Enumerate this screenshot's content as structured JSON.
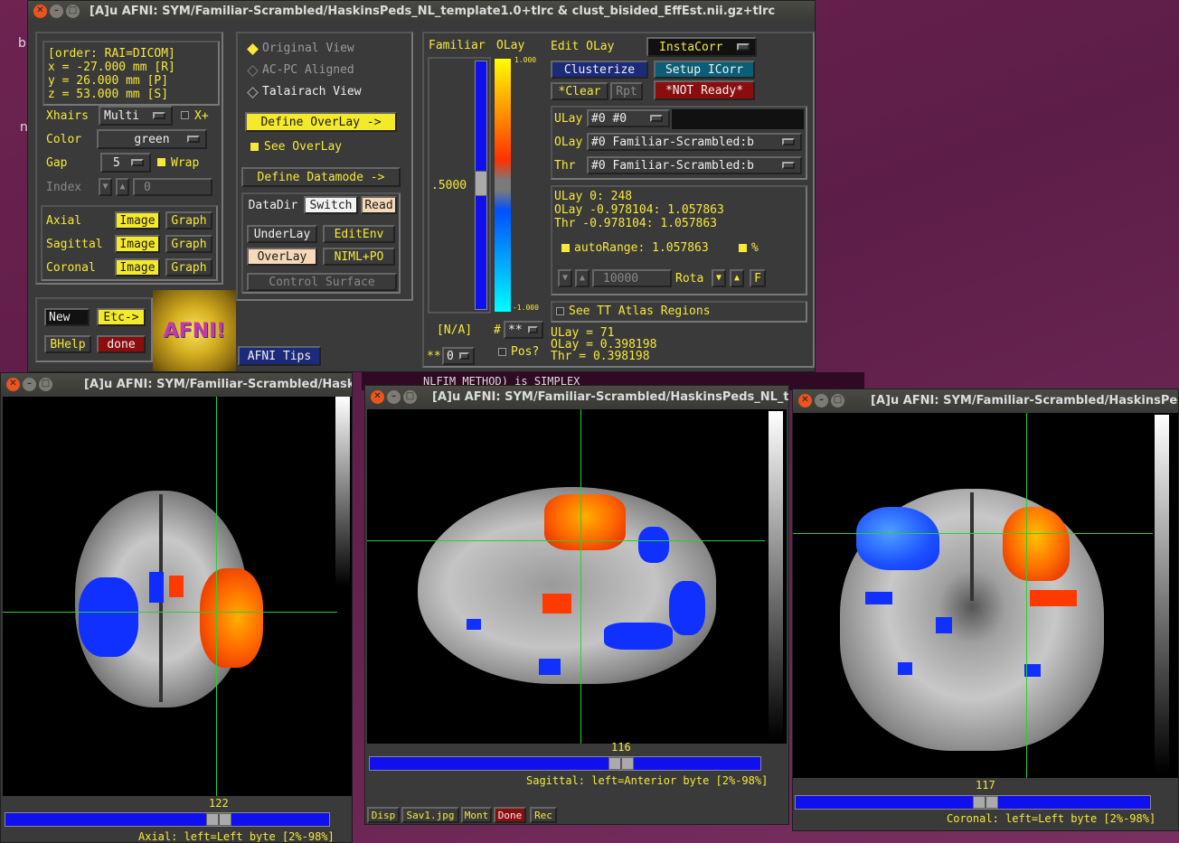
{
  "desktop": {
    "left_text_1": "b",
    "left_text_2": "n"
  },
  "control": {
    "title": "[A]u AFNI: SYM/Familiar-Scrambled/HaskinsPeds_NL_template1.0+tlrc & clust_bisided_EffEst.nii.gz+tlrc",
    "coords": {
      "order": "[order: RAI=DICOM]",
      "x": "x =   -27.000 mm [R]",
      "y": "y =    26.000 mm [P]",
      "z": "z =    53.000 mm [S]"
    },
    "xhairs_label": "Xhairs",
    "xhairs_value": "Multi",
    "xplus": "X+",
    "color_label": "Color",
    "color_value": "green",
    "gap_label": "Gap",
    "gap_value": "5",
    "wrap": "Wrap",
    "index_label": "Index",
    "index_value": "0",
    "views": [
      {
        "name": "Axial",
        "image": "Image",
        "graph": "Graph"
      },
      {
        "name": "Sagittal",
        "image": "Image",
        "graph": "Graph"
      },
      {
        "name": "Coronal",
        "image": "Image",
        "graph": "Graph"
      }
    ],
    "new": "New",
    "etc": "Etc->",
    "bhelp": "BHelp",
    "done": "done",
    "logo": "AFNI!",
    "space": {
      "original": "Original View",
      "acpc": "AC-PC Aligned",
      "talairach": "Talairach View"
    },
    "define_overlay": "Define OverLay ->",
    "see_overlay": "See OverLay",
    "define_datamode": "Define Datamode ->",
    "datadir": "DataDir",
    "switch": "Switch",
    "read": "Read",
    "underlay": "UnderLay",
    "editenv": "EditEnv",
    "overlay": "OverLay",
    "niml": "NIML+PO",
    "control_surface": "Control Surface",
    "afni_tips": "AFNI Tips"
  },
  "overlay_panel": {
    "familiar": "Familiar",
    "olay": "OLay",
    "scale_top": "1.000",
    "scale_bot": "-1.000",
    "threshold": ".5000",
    "na": "[N/A]",
    "hash": "#",
    "hash_val": "**",
    "stars": "**",
    "stars_val": "0",
    "pos": "Pos?",
    "edit_olay": "Edit OLay",
    "instacorr": "InstaCorr",
    "clusterize": "Clusterize",
    "setup_icorr": "Setup ICorr",
    "clear": "*Clear",
    "rpt": "Rpt",
    "not_ready": "*NOT Ready*",
    "ulay_label": "ULay",
    "ulay_value": "#0 #0",
    "olay_label": "OLay",
    "olay_value": "#0 Familiar-Scrambled:b",
    "thr_label": "Thr",
    "thr_value": "#0 Familiar-Scrambled:b",
    "info": {
      "ulay": "ULay        0:       248",
      "olay": "OLay -0.978104: 1.057863",
      "thr": "Thr  -0.978104: 1.057863"
    },
    "autorange": "autoRange: 1.057863",
    "pct": "%",
    "rota_value": "10000",
    "rota": "Rota",
    "f": "F",
    "see_tt": "See TT Atlas Regions",
    "vals": {
      "ulay": "ULay = 71",
      "olay": "OLay = 0.398198",
      "thr": "Thr  = 0.398198"
    }
  },
  "axial": {
    "title": "[A]u AFNI: SYM/Familiar-Scrambled/HaskinsPeds_",
    "slice": "122",
    "status": "Axial: left=Left byte [2%-98%]"
  },
  "sagittal": {
    "title": "[A]u AFNI: SYM/Familiar-Scrambled/HaskinsPeds_NL_t",
    "slice": "116",
    "status": "Sagittal: left=Anterior byte [2%-98%]",
    "buttons": [
      "Disp",
      "Sav1.jpg",
      "Mont",
      "Done",
      "Rec"
    ]
  },
  "coronal": {
    "title": "[A]u AFNI: SYM/Familiar-Scrambled/HaskinsPeds_",
    "slice": "117",
    "status": "Coronal: left=Left byte [2%-98%]"
  },
  "terminal_text": "NLFIM_METHOD) is SIMPLEX",
  "colors": {
    "accent": "#f7e83a",
    "crosshair": "#29d02c",
    "titlebar": "#3c3c38",
    "panel": "#3a3a3a"
  }
}
